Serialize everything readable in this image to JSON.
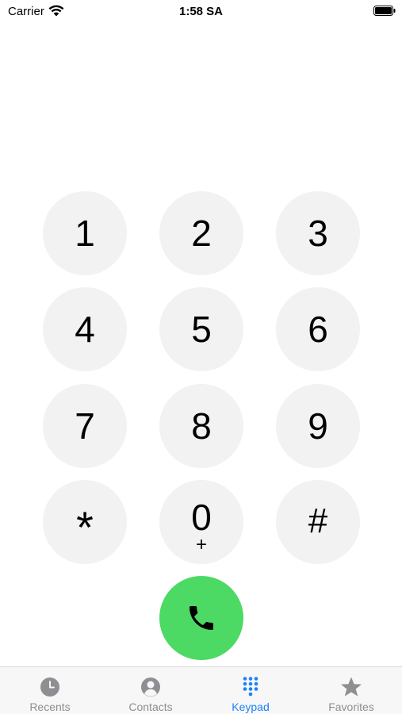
{
  "status_bar": {
    "carrier": "Carrier",
    "time": "1:58 SA",
    "wifi_icon": "wifi-icon",
    "battery_icon": "battery-full-icon"
  },
  "keypad": {
    "keys": [
      {
        "digit": "1",
        "sub": ""
      },
      {
        "digit": "2",
        "sub": ""
      },
      {
        "digit": "3",
        "sub": ""
      },
      {
        "digit": "4",
        "sub": ""
      },
      {
        "digit": "5",
        "sub": ""
      },
      {
        "digit": "6",
        "sub": ""
      },
      {
        "digit": "7",
        "sub": ""
      },
      {
        "digit": "8",
        "sub": ""
      },
      {
        "digit": "9",
        "sub": ""
      },
      {
        "digit": "*",
        "sub": ""
      },
      {
        "digit": "0",
        "sub": "+"
      },
      {
        "digit": "#",
        "sub": ""
      }
    ],
    "call_icon": "phone-icon",
    "key_color": "#f2f2f2",
    "call_color": "#4cd964"
  },
  "tab_bar": {
    "active_color": "#1a82fb",
    "inactive_color": "#8e8e93",
    "tabs": [
      {
        "label": "Recents",
        "icon": "clock-icon",
        "active": false
      },
      {
        "label": "Contacts",
        "icon": "person-circle-icon",
        "active": false
      },
      {
        "label": "Keypad",
        "icon": "keypad-grid-icon",
        "active": true
      },
      {
        "label": "Favorites",
        "icon": "star-icon",
        "active": false
      }
    ]
  }
}
